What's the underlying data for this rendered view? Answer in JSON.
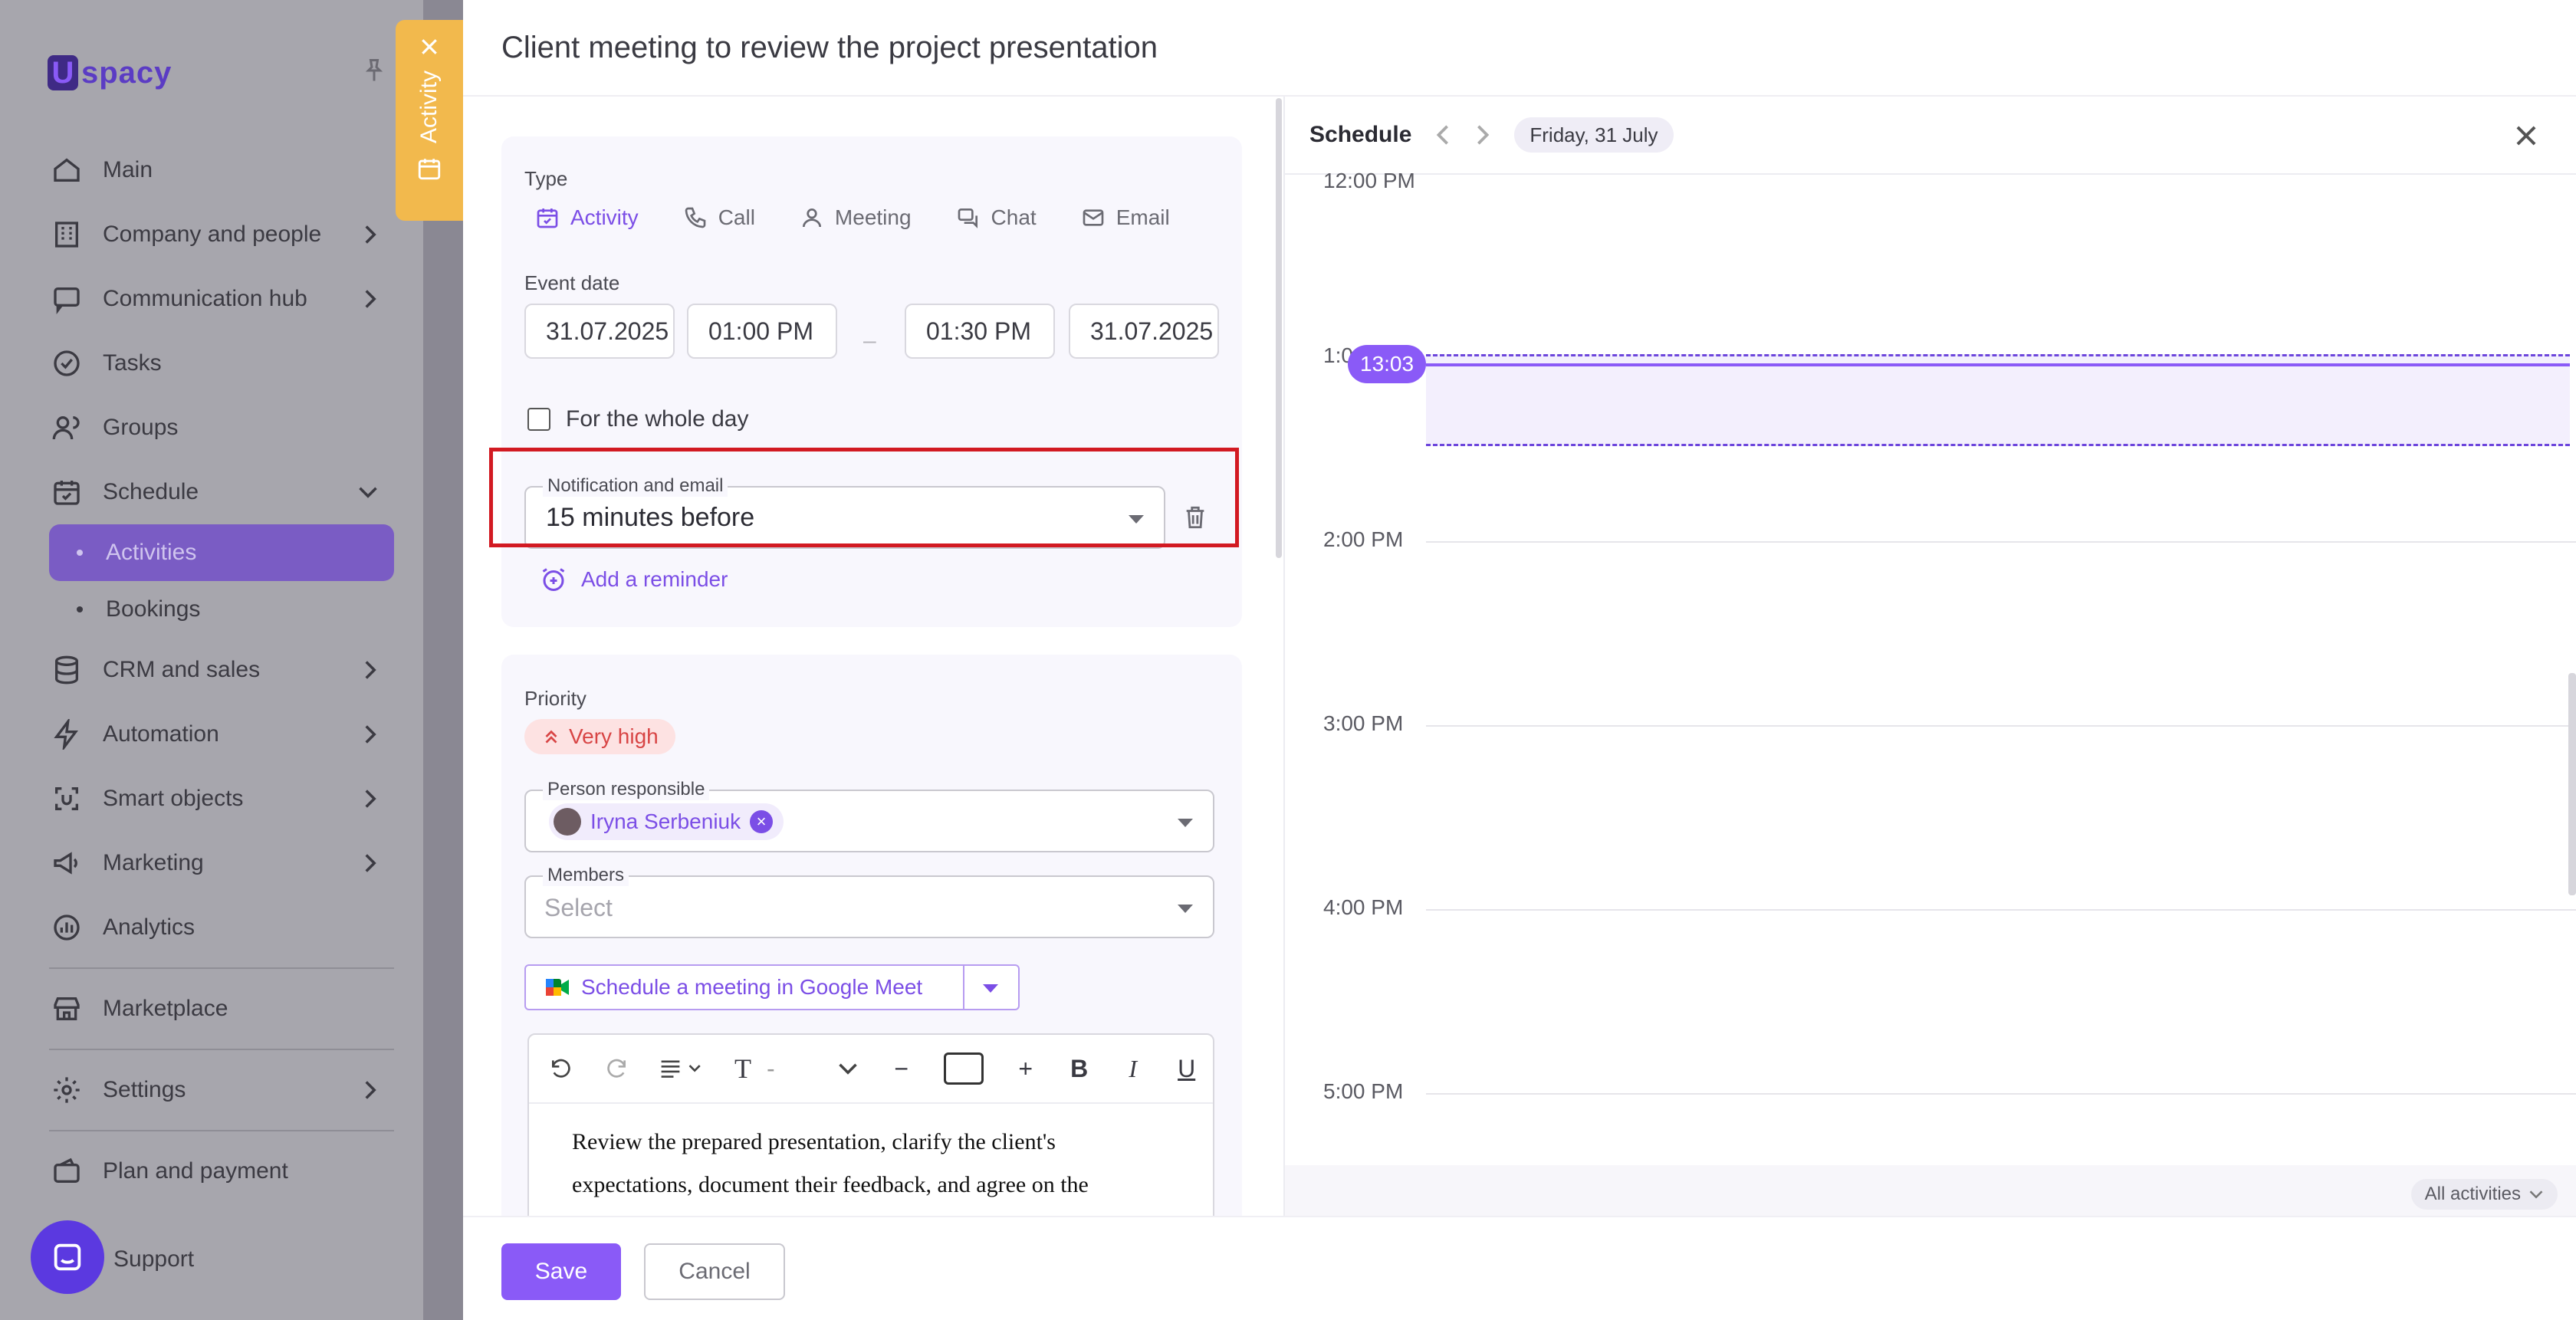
{
  "sidebar": {
    "logo_text": "spacy",
    "logo_mark": "U",
    "items": [
      {
        "label": "Main",
        "icon": "home-icon"
      },
      {
        "label": "Company and people",
        "icon": "building-icon"
      },
      {
        "label": "Communication hub",
        "icon": "chat-icon"
      },
      {
        "label": "Tasks",
        "icon": "check-circle-icon"
      },
      {
        "label": "Groups",
        "icon": "users-icon"
      },
      {
        "label": "Schedule",
        "icon": "calendar-icon"
      },
      {
        "label": "CRM and sales",
        "icon": "database-icon"
      },
      {
        "label": "Automation",
        "icon": "lightning-icon"
      },
      {
        "label": "Smart objects",
        "icon": "smart-object-icon"
      },
      {
        "label": "Marketing",
        "icon": "megaphone-icon"
      },
      {
        "label": "Analytics",
        "icon": "chart-icon"
      },
      {
        "label": "Marketplace",
        "icon": "store-icon"
      },
      {
        "label": "Settings",
        "icon": "gear-icon"
      },
      {
        "label": "Plan and payment",
        "icon": "wallet-icon"
      }
    ],
    "sub_items": [
      {
        "label": "Activities"
      },
      {
        "label": "Bookings"
      }
    ],
    "support_label": "Support"
  },
  "activity_tab": {
    "label": "Activity"
  },
  "drawer": {
    "title": "Client meeting to review the project presentation"
  },
  "form": {
    "type_label": "Type",
    "types": [
      {
        "label": "Activity",
        "icon": "calendar-check-icon"
      },
      {
        "label": "Call",
        "icon": "phone-icon"
      },
      {
        "label": "Meeting",
        "icon": "person-icon"
      },
      {
        "label": "Chat",
        "icon": "chat-bubbles-icon"
      },
      {
        "label": "Email",
        "icon": "envelope-icon"
      }
    ],
    "selected_type": "Activity",
    "event_date_label": "Event date",
    "start_date": "31.07.2025",
    "start_time": "01:00 PM",
    "date_separator": "–",
    "end_time": "01:30 PM",
    "end_date": "31.07.2025",
    "whole_day_label": "For the whole day",
    "notification_legend": "Notification and email",
    "notification_value": "15 minutes before",
    "add_reminder_label": "Add a reminder",
    "priority_label": "Priority",
    "priority_value": "Very high",
    "person_responsible_legend": "Person responsible",
    "person_responsible_name": "Iryna Serbeniuk",
    "members_legend": "Members",
    "members_placeholder": "Select",
    "google_meet_label": "Schedule a meeting in Google Meet",
    "toolbar": {
      "font_size_placeholder": "-",
      "bold": "B",
      "italic": "I",
      "underline": "U",
      "text_icon": "T",
      "minus": "−",
      "plus": "+"
    },
    "description": "Review the prepared presentation, clarify the client's expectations, document their feedback, and agree on the"
  },
  "footer": {
    "save_label": "Save",
    "cancel_label": "Cancel"
  },
  "schedule": {
    "title": "Schedule",
    "date": "Friday, 31 July",
    "hours": [
      "12:00 PM",
      "1:00 PM",
      "2:00 PM",
      "3:00 PM",
      "4:00 PM",
      "5:00 PM"
    ],
    "now_time": "13:03",
    "all_activities_label": "All activities"
  },
  "colors": {
    "accent": "#8a5af7",
    "activity_tab": "#f2b94d",
    "priority_high": "#d84545",
    "highlight_frame": "#d21a22"
  }
}
